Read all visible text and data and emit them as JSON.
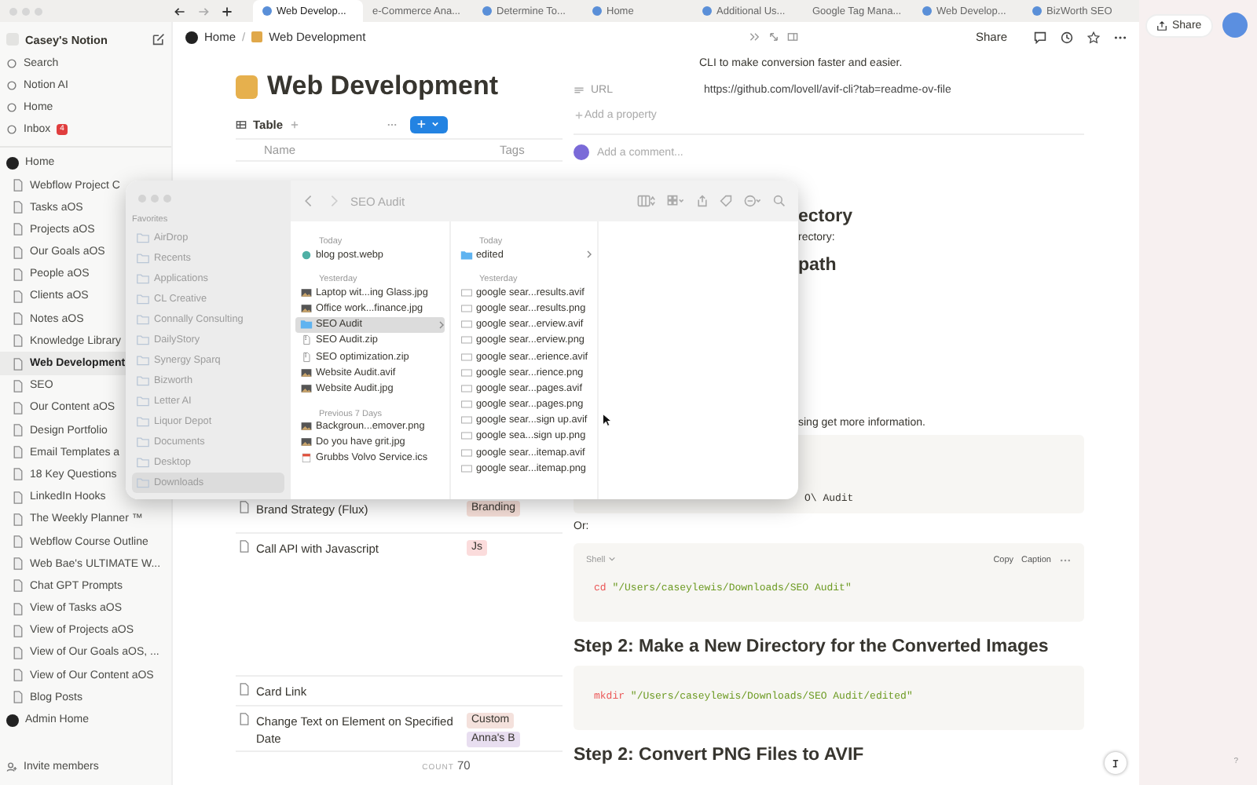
{
  "browser": {
    "tabs": [
      {
        "label": "Web Develop...",
        "icon": true,
        "selected": true
      },
      {
        "label": "e-Commerce Ana...",
        "icon": false,
        "selected": false
      },
      {
        "label": "Determine To...",
        "icon": true,
        "selected": false
      },
      {
        "label": "Home",
        "icon": true,
        "selected": false
      },
      {
        "label": "Additional Us...",
        "icon": true,
        "selected": false
      },
      {
        "label": "Google Tag Mana...",
        "icon": false,
        "selected": false
      },
      {
        "label": "Web Develop...",
        "icon": true,
        "selected": false
      },
      {
        "label": "BizWorth SEO",
        "icon": true,
        "selected": false
      }
    ]
  },
  "sidebar": {
    "workspace": "Casey's Notion",
    "nav": [
      {
        "label": "Search",
        "selected": false
      },
      {
        "label": "Notion AI",
        "selected": false
      },
      {
        "label": "Home",
        "selected": false
      },
      {
        "label": "Inbox",
        "badge": "4",
        "selected": false
      }
    ],
    "tree": [
      {
        "label": "Home",
        "selected": false,
        "children": [
          {
            "label": "Webflow Project C",
            "selected": false
          },
          {
            "label": "Tasks aOS",
            "selected": false
          },
          {
            "label": "Projects aOS",
            "selected": false
          },
          {
            "label": "Our Goals aOS",
            "selected": false
          },
          {
            "label": "People aOS",
            "selected": false
          },
          {
            "label": "Clients aOS",
            "selected": false
          },
          {
            "label": "Notes aOS",
            "selected": false
          },
          {
            "label": "Knowledge Library",
            "selected": false
          },
          {
            "label": "Web Development",
            "selected": true
          },
          {
            "label": "SEO",
            "selected": false
          },
          {
            "label": "Our Content aOS",
            "selected": false
          },
          {
            "label": "Design Portfolio",
            "selected": false
          },
          {
            "label": "Email Templates a",
            "selected": false
          },
          {
            "label": "18 Key Questions",
            "selected": false
          },
          {
            "label": "LinkedIn Hooks",
            "selected": false
          },
          {
            "label": "The Weekly Planner ™",
            "selected": false
          },
          {
            "label": "Webflow Course Outline",
            "selected": false
          },
          {
            "label": "Web Bae's ULTIMATE W...",
            "selected": false
          },
          {
            "label": "Chat GPT Prompts",
            "selected": false
          },
          {
            "label": "View of Tasks aOS",
            "selected": false
          },
          {
            "label": "View of Projects aOS",
            "selected": false
          },
          {
            "label": "View of Our Goals aOS, ...",
            "selected": false
          },
          {
            "label": "View of Our Content aOS",
            "selected": false
          },
          {
            "label": "Blog Posts",
            "selected": false
          }
        ]
      },
      {
        "label": "Admin Home",
        "selected": false
      }
    ],
    "footer": "Invite members"
  },
  "topbar": {
    "breadcrumb": [
      "Home",
      "Web Development"
    ],
    "separator": "/",
    "share": "Share"
  },
  "side_window": {
    "share": "Share",
    "help": "?"
  },
  "database": {
    "title": "Web Development",
    "view": "Table",
    "columns": [
      "Name",
      "Tags"
    ],
    "rows": [
      {
        "name": "Brand Strategy (Flux)",
        "tags": [
          {
            "label": "Branding",
            "color": "#f6dfd8"
          }
        ]
      },
      {
        "name": "Call API with Javascript",
        "tags": [
          {
            "label": "Js",
            "color": "#fbdcdc"
          }
        ]
      },
      {
        "name": "Card Link",
        "tags": []
      },
      {
        "name": "Change Text on Element on Specified Date",
        "tags": [
          {
            "label": "Custom",
            "color": "#f4e1dc"
          },
          {
            "label": "Anna's B",
            "color": "#e8def0"
          }
        ]
      }
    ],
    "count_label": "COUNT",
    "count": "70"
  },
  "page": {
    "description": "CLI to make conversion faster and easier.",
    "properties": [
      {
        "name": "URL",
        "value": "https://github.com/lovell/avif-cli?tab=readme-ov-file"
      }
    ],
    "add_property": "Add a property",
    "comment_placeholder": "Add a comment...",
    "blocks": [
      {
        "kind": "heading_fragment",
        "text": "ectory"
      },
      {
        "kind": "text_fragment",
        "text": "rectory:"
      },
      {
        "kind": "heading_fragment",
        "text": "path"
      },
      {
        "kind": "text_fragment",
        "text": "sing get more information."
      },
      {
        "kind": "code_fragment",
        "text": "O\\ Audit"
      },
      {
        "kind": "text",
        "text": "Or:"
      },
      {
        "kind": "code",
        "language": "Shell",
        "actions": [
          "Copy",
          "Caption"
        ],
        "command": "cd",
        "argument": "\"/Users/caseylewis/Downloads/SEO Audit\""
      },
      {
        "kind": "heading",
        "text": "Step 2: Make a New Directory for the Converted Images"
      },
      {
        "kind": "code",
        "command": "mkdir",
        "argument": "\"/Users/caseylewis/Downloads/SEO Audit/edited\""
      },
      {
        "kind": "heading",
        "text": "Step 2: Convert PNG Files to AVIF"
      }
    ]
  },
  "finder": {
    "title": "SEO Audit",
    "sidebar_heading": "Favorites",
    "places": [
      {
        "label": "AirDrop",
        "selected": false
      },
      {
        "label": "Recents",
        "selected": false
      },
      {
        "label": "Applications",
        "selected": false
      },
      {
        "label": "CL Creative",
        "selected": false
      },
      {
        "label": "Connally Consulting",
        "selected": false
      },
      {
        "label": "DailyStory",
        "selected": false
      },
      {
        "label": "Synergy Sparq",
        "selected": false
      },
      {
        "label": "Bizworth",
        "selected": false
      },
      {
        "label": "Letter AI",
        "selected": false
      },
      {
        "label": "Liquor Depot",
        "selected": false
      },
      {
        "label": "Documents",
        "selected": false
      },
      {
        "label": "Desktop",
        "selected": false
      },
      {
        "label": "Downloads",
        "selected": true
      }
    ],
    "columns": [
      {
        "groups": [
          {
            "heading": "Today",
            "items": [
              {
                "name": "blog post.webp",
                "kind": "web",
                "selected": false
              }
            ]
          },
          {
            "heading": "Yesterday",
            "items": [
              {
                "name": "Laptop wit...ing Glass.jpg",
                "kind": "image",
                "selected": false
              },
              {
                "name": "Office work...finance.jpg",
                "kind": "image",
                "selected": false
              },
              {
                "name": "SEO Audit",
                "kind": "folder",
                "selected": true
              },
              {
                "name": "SEO Audit.zip",
                "kind": "archive",
                "selected": false
              },
              {
                "name": "SEO optimization.zip",
                "kind": "archive",
                "selected": false
              },
              {
                "name": "Website Audit.avif",
                "kind": "image",
                "selected": false
              },
              {
                "name": "Website Audit.jpg",
                "kind": "image",
                "selected": false
              }
            ]
          },
          {
            "heading": "Previous 7 Days",
            "items": [
              {
                "name": "Backgroun...emover.png",
                "kind": "image",
                "selected": false
              },
              {
                "name": "Do you have grit.jpg",
                "kind": "image",
                "selected": false
              },
              {
                "name": "Grubbs Volvo Service.ics",
                "kind": "calendar",
                "selected": false
              }
            ]
          }
        ]
      },
      {
        "groups": [
          {
            "heading": "Today",
            "items": [
              {
                "name": "edited",
                "kind": "folder",
                "selected": false
              }
            ]
          },
          {
            "heading": "Yesterday",
            "items": [
              {
                "name": "google sear...results.avif",
                "kind": "doc",
                "selected": false
              },
              {
                "name": "google sear...results.png",
                "kind": "doc",
                "selected": false
              },
              {
                "name": "google sear...erview.avif",
                "kind": "doc",
                "selected": false
              },
              {
                "name": "google sear...erview.png",
                "kind": "doc",
                "selected": false
              },
              {
                "name": "google sear...erience.avif",
                "kind": "doc",
                "selected": false
              },
              {
                "name": "google sear...rience.png",
                "kind": "doc",
                "selected": false
              },
              {
                "name": "google sear...pages.avif",
                "kind": "doc",
                "selected": false
              },
              {
                "name": "google sear...pages.png",
                "kind": "doc",
                "selected": false
              },
              {
                "name": "google sear...sign up.avif",
                "kind": "doc",
                "selected": false
              },
              {
                "name": "google sea...sign up.png",
                "kind": "doc",
                "selected": false
              },
              {
                "name": "google sear...itemap.avif",
                "kind": "doc",
                "selected": false
              },
              {
                "name": "google sear...itemap.png",
                "kind": "doc",
                "selected": false
              }
            ]
          }
        ]
      }
    ]
  }
}
